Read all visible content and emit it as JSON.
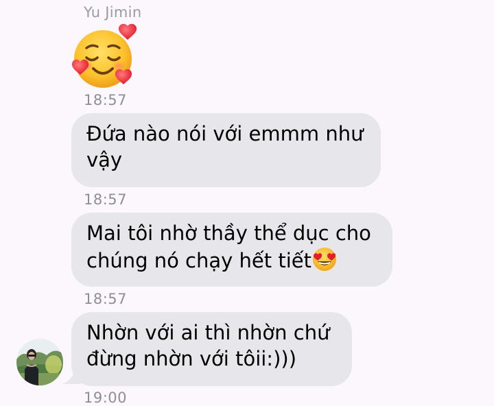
{
  "sender": {
    "name": "Yu Jimin",
    "avatar_icon": "profile-photo-avatar"
  },
  "messages": [
    {
      "type": "sticker",
      "icon": "smiling-face-with-hearts-emoji",
      "time": "18:57"
    },
    {
      "type": "text",
      "lines": [
        "Đứa nào nói với emmm như",
        "vậy"
      ],
      "time": "18:57"
    },
    {
      "type": "text",
      "lines": [
        "Mai tôi nhờ thầy thể dục cho",
        "chúng nó chạy hết tiết"
      ],
      "trailing_icon": "heart-eyes-emoji",
      "time": "18:57"
    },
    {
      "type": "text",
      "lines": [
        "Nhờn với ai thì nhờn chứ",
        "đừng nhờn với tôii:)))"
      ],
      "time": "19:00"
    }
  ],
  "colors": {
    "background": "#fcf7fc",
    "bubble": "#e6e6eb",
    "meta_text": "#8e8e93"
  }
}
